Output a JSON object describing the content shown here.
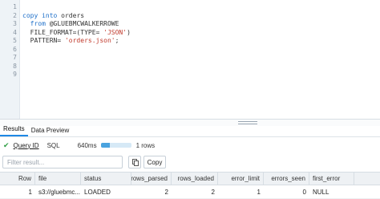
{
  "editor": {
    "line_numbers": [
      "1",
      "2",
      "3",
      "4",
      "5",
      "6",
      "7",
      "8",
      "9"
    ],
    "lines": [
      {
        "kind": "blank"
      },
      {
        "kind": "kw_plain",
        "kw": "copy into",
        "rest": " orders"
      },
      {
        "kind": "kw_plain",
        "kw": "  from",
        "rest": " @GLUEBMCWALKERROWE"
      },
      {
        "kind": "mixed",
        "pre": "  FILE_FORMAT=(TYPE= ",
        "str": "'JSON'",
        "post": ")"
      },
      {
        "kind": "mixed",
        "pre": "  PATTERN= ",
        "str": "'orders.json'",
        "post": ";"
      },
      {
        "kind": "blank"
      },
      {
        "kind": "blank"
      },
      {
        "kind": "blank"
      },
      {
        "kind": "blank"
      }
    ]
  },
  "tabs": [
    "Results",
    "Data Preview"
  ],
  "status": {
    "check_icon": "check-icon",
    "query_id": "Query ID",
    "sql": "SQL",
    "elapsed": "640ms",
    "progress_fraction": 0.3,
    "rows": "1 rows"
  },
  "filter": {
    "placeholder": "Filter result..."
  },
  "copy_icon": "copy-icon",
  "copy_label": "Copy",
  "table": {
    "columns": [
      "Row",
      "file",
      "status",
      "rows_parsed",
      "rows_loaded",
      "error_limit",
      "errors_seen",
      "first_error"
    ],
    "rows": [
      [
        "1",
        "s3://gluebmc...",
        "LOADED",
        "2",
        "2",
        "1",
        "0",
        "NULL"
      ]
    ]
  }
}
